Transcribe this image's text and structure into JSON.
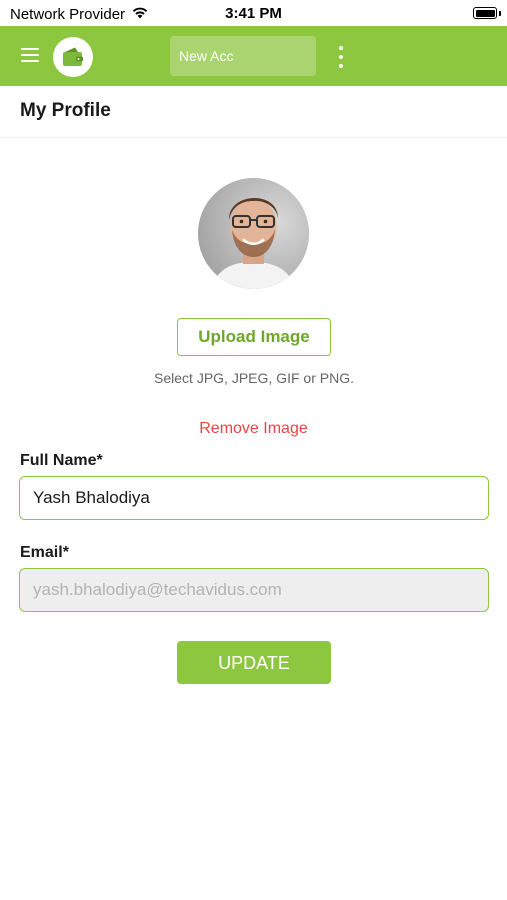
{
  "status_bar": {
    "carrier": "Network Provider",
    "time": "3:41 PM",
    "wifi_icon": "wifi-icon",
    "battery_icon": "battery-icon",
    "battery_level": 1.0
  },
  "app_bar": {
    "menu_icon": "hamburger-menu-icon",
    "logo_icon": "wallet-logo-icon",
    "account_name": "New Acc",
    "more_icon": "vertical-dots-icon",
    "background_color": "#8dc63f"
  },
  "page": {
    "title": "My Profile"
  },
  "profile": {
    "upload_label": "Upload Image",
    "upload_hint": "Select JPG, JPEG, GIF or PNG.",
    "remove_label": "Remove Image"
  },
  "form": {
    "full_name_label": "Full Name*",
    "full_name_value": "Yash Bhalodiya",
    "email_label": "Email*",
    "email_placeholder": "yash.bhalodiya@techavidus.com",
    "submit_label": "UPDATE"
  },
  "colors": {
    "accent": "#8dc63f",
    "danger": "#e84545"
  }
}
